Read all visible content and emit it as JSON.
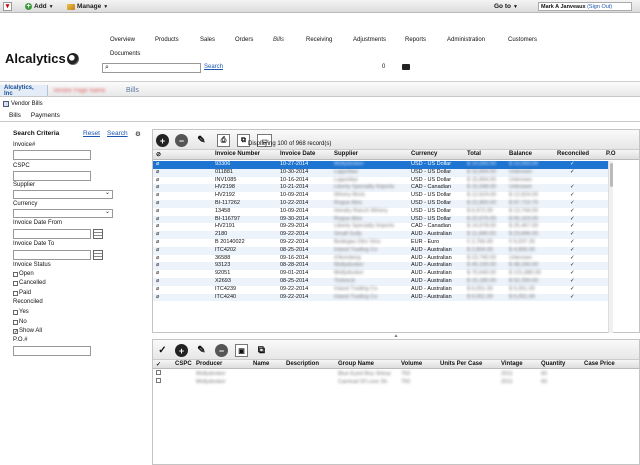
{
  "topbar": {
    "add_label": "Add",
    "manage_label": "Manage",
    "goto_label": "Go to",
    "user_label": "Mark A Janveaux",
    "signout_label": "(Sign Out)"
  },
  "header": {
    "logo": "Alcalytics",
    "nav": [
      "Overview",
      "Products",
      "Sales",
      "Orders",
      "Bills",
      "Receiving",
      "Adjustments",
      "Reports",
      "Administration",
      "Customers"
    ],
    "documents": "Documents",
    "search_link": "Search",
    "notification_count": "0"
  },
  "breadcrumb": {
    "company": "Alcalytics, Inc",
    "vendor": "Vendor Page Name",
    "current": "Bills"
  },
  "page": {
    "title": "Vendor Bills",
    "tabs": [
      "Bills",
      "Payments"
    ]
  },
  "criteria": {
    "title": "Search Criteria",
    "reset": "Reset",
    "search": "Search",
    "gear": "⚙",
    "fields": {
      "invoice": "Invoice#",
      "cspc": "CSPC",
      "supplier": "Supplier",
      "currency": "Currency",
      "date_from": "Invoice Date From",
      "date_to": "Invoice Date To",
      "status": "Invoice Status",
      "reconciled": "Reconciled",
      "po": "P.O.#"
    },
    "status_options": [
      "Open",
      "Cancelled",
      "Paid"
    ],
    "reconciled_options": [
      "Yes",
      "No",
      "Show All"
    ],
    "show_all_mark": "✓"
  },
  "bills": {
    "records_text": "Displaying 100 of 968 record(s)",
    "columns": [
      "Invoice Number",
      "Invoice Date",
      "Supplier",
      "Currency",
      "Total",
      "Balance",
      "Reconciled",
      "P.O"
    ],
    "rows": [
      {
        "inv": "93306",
        "date": "10-27-2014",
        "supplier": "Mollydooker",
        "currency": "USD - US Dollar",
        "total": "$ 10,000.00",
        "balance": "$ 10,000.00",
        "rec": "✓"
      },
      {
        "inv": "011881",
        "date": "10-30-2014",
        "supplier": "Lagunitas",
        "currency": "USD - US Dollar",
        "total": "$ 15,894.00",
        "balance": "Unknown",
        "rec": "✓"
      },
      {
        "inv": "INV1085",
        "date": "10-16-2014",
        "supplier": "Lagunitas",
        "currency": "USD - US Dollar",
        "total": "$ 15,894.00",
        "balance": "Unknown",
        "rec": ""
      },
      {
        "inv": "HV2198",
        "date": "10-21-2014",
        "supplier": "Liberty Specialty Imports",
        "currency": "CAD - Canadian",
        "total": "$ 15,048.00",
        "balance": "Unknown",
        "rec": "✓"
      },
      {
        "inv": "HV2192",
        "date": "10-09-2014",
        "supplier": "Winery Brick",
        "currency": "USD - US Dollar",
        "total": "$ 12,624.00",
        "balance": "$ 12,624.00",
        "rec": "✓"
      },
      {
        "inv": "BI-117262",
        "date": "10-22-2014",
        "supplier": "Rogue Ales",
        "currency": "USD - US Dollar",
        "total": "$ 22,800.00",
        "balance": "$ 97,710.70",
        "rec": "✓"
      },
      {
        "inv": "13458",
        "date": "10-09-2014",
        "supplier": "Hendry Ranch Winery",
        "currency": "USD - US Dollar",
        "total": "$ 6,972.00",
        "balance": "$ 13,744.00",
        "rec": "✓"
      },
      {
        "inv": "BI-116797",
        "date": "09-30-2014",
        "supplier": "Rogue Ales",
        "currency": "USD - US Dollar",
        "total": "$ 22,676.00",
        "balance": "$ 65,163.00",
        "rec": "✓"
      },
      {
        "inv": "HV2191",
        "date": "09-29-2014",
        "supplier": "Liberty Specialty Imports",
        "currency": "CAD - Canadian",
        "total": "$ 14,678.00",
        "balance": "$ 25,467.00",
        "rec": "✓"
      },
      {
        "inv": "2180",
        "date": "09-22-2014",
        "supplier": "Small Gully",
        "currency": "AUD - Australian",
        "total": "$ 11,840.00",
        "balance": "$ 23,846.00",
        "rec": "✓"
      },
      {
        "inv": "B 20140022",
        "date": "09-22-2014",
        "supplier": "Bodegas Otro Vino",
        "currency": "EUR - Euro",
        "total": "€ 2,766.00",
        "balance": "€ 6,037.26",
        "rec": "✓"
      },
      {
        "inv": "ITC4202",
        "date": "08-25-2014",
        "supplier": "Inland Trading Co",
        "currency": "AUD - Australian",
        "total": "$ 2,804.00",
        "balance": "$ 4,806.00",
        "rec": "✓"
      },
      {
        "inv": "36588",
        "date": "09-16-2014",
        "supplier": "d'Arenberg",
        "currency": "AUD - Australian",
        "total": "$ 23,740.00",
        "balance": "Unknown",
        "rec": "✓"
      },
      {
        "inv": "93123",
        "date": "08-28-2014",
        "supplier": "Mollydooker",
        "currency": "AUD - Australian",
        "total": "$ 49,100.00",
        "balance": "$ 48,240.00",
        "rec": "✓"
      },
      {
        "inv": "92051",
        "date": "09-01-2014",
        "supplier": "Mollydooker",
        "currency": "AUD - Australian",
        "total": "$ 70,640.00",
        "balance": "$ 131,880.00",
        "rec": "✓"
      },
      {
        "inv": "X2693",
        "date": "08-25-2014",
        "supplier": "Torbreck",
        "currency": "AUD - Australian",
        "total": "$ 15,180.00",
        "balance": "$ 52,290.00",
        "rec": "✓"
      },
      {
        "inv": "ITC4239",
        "date": "09-22-2014",
        "supplier": "Inland Trading Co",
        "currency": "AUD - Australian",
        "total": "$ 6,051.00",
        "balance": "$ 6,051.00",
        "rec": "✓"
      },
      {
        "inv": "ITC4240",
        "date": "09-22-2014",
        "supplier": "Inland Trading Co",
        "currency": "AUD - Australian",
        "total": "$ 6,051.00",
        "balance": "$ 6,051.00",
        "rec": "✓"
      }
    ]
  },
  "items": {
    "check_mark": "✓",
    "columns": [
      "CSPC",
      "Producer",
      "Name",
      "Description",
      "Group Name",
      "Volume",
      "Units Per Case",
      "Vintage",
      "Quantity",
      "Case Price"
    ],
    "rows": [
      {
        "producer": "Mollydooker",
        "group": "Blue Eyed Boy Shiraz",
        "volume": "750",
        "vintage": "2011",
        "quantity": "60"
      },
      {
        "producer": "Mollydooker",
        "group": "Carnival Of Love Sh",
        "volume": "750",
        "vintage": "2011",
        "quantity": "60"
      }
    ]
  }
}
